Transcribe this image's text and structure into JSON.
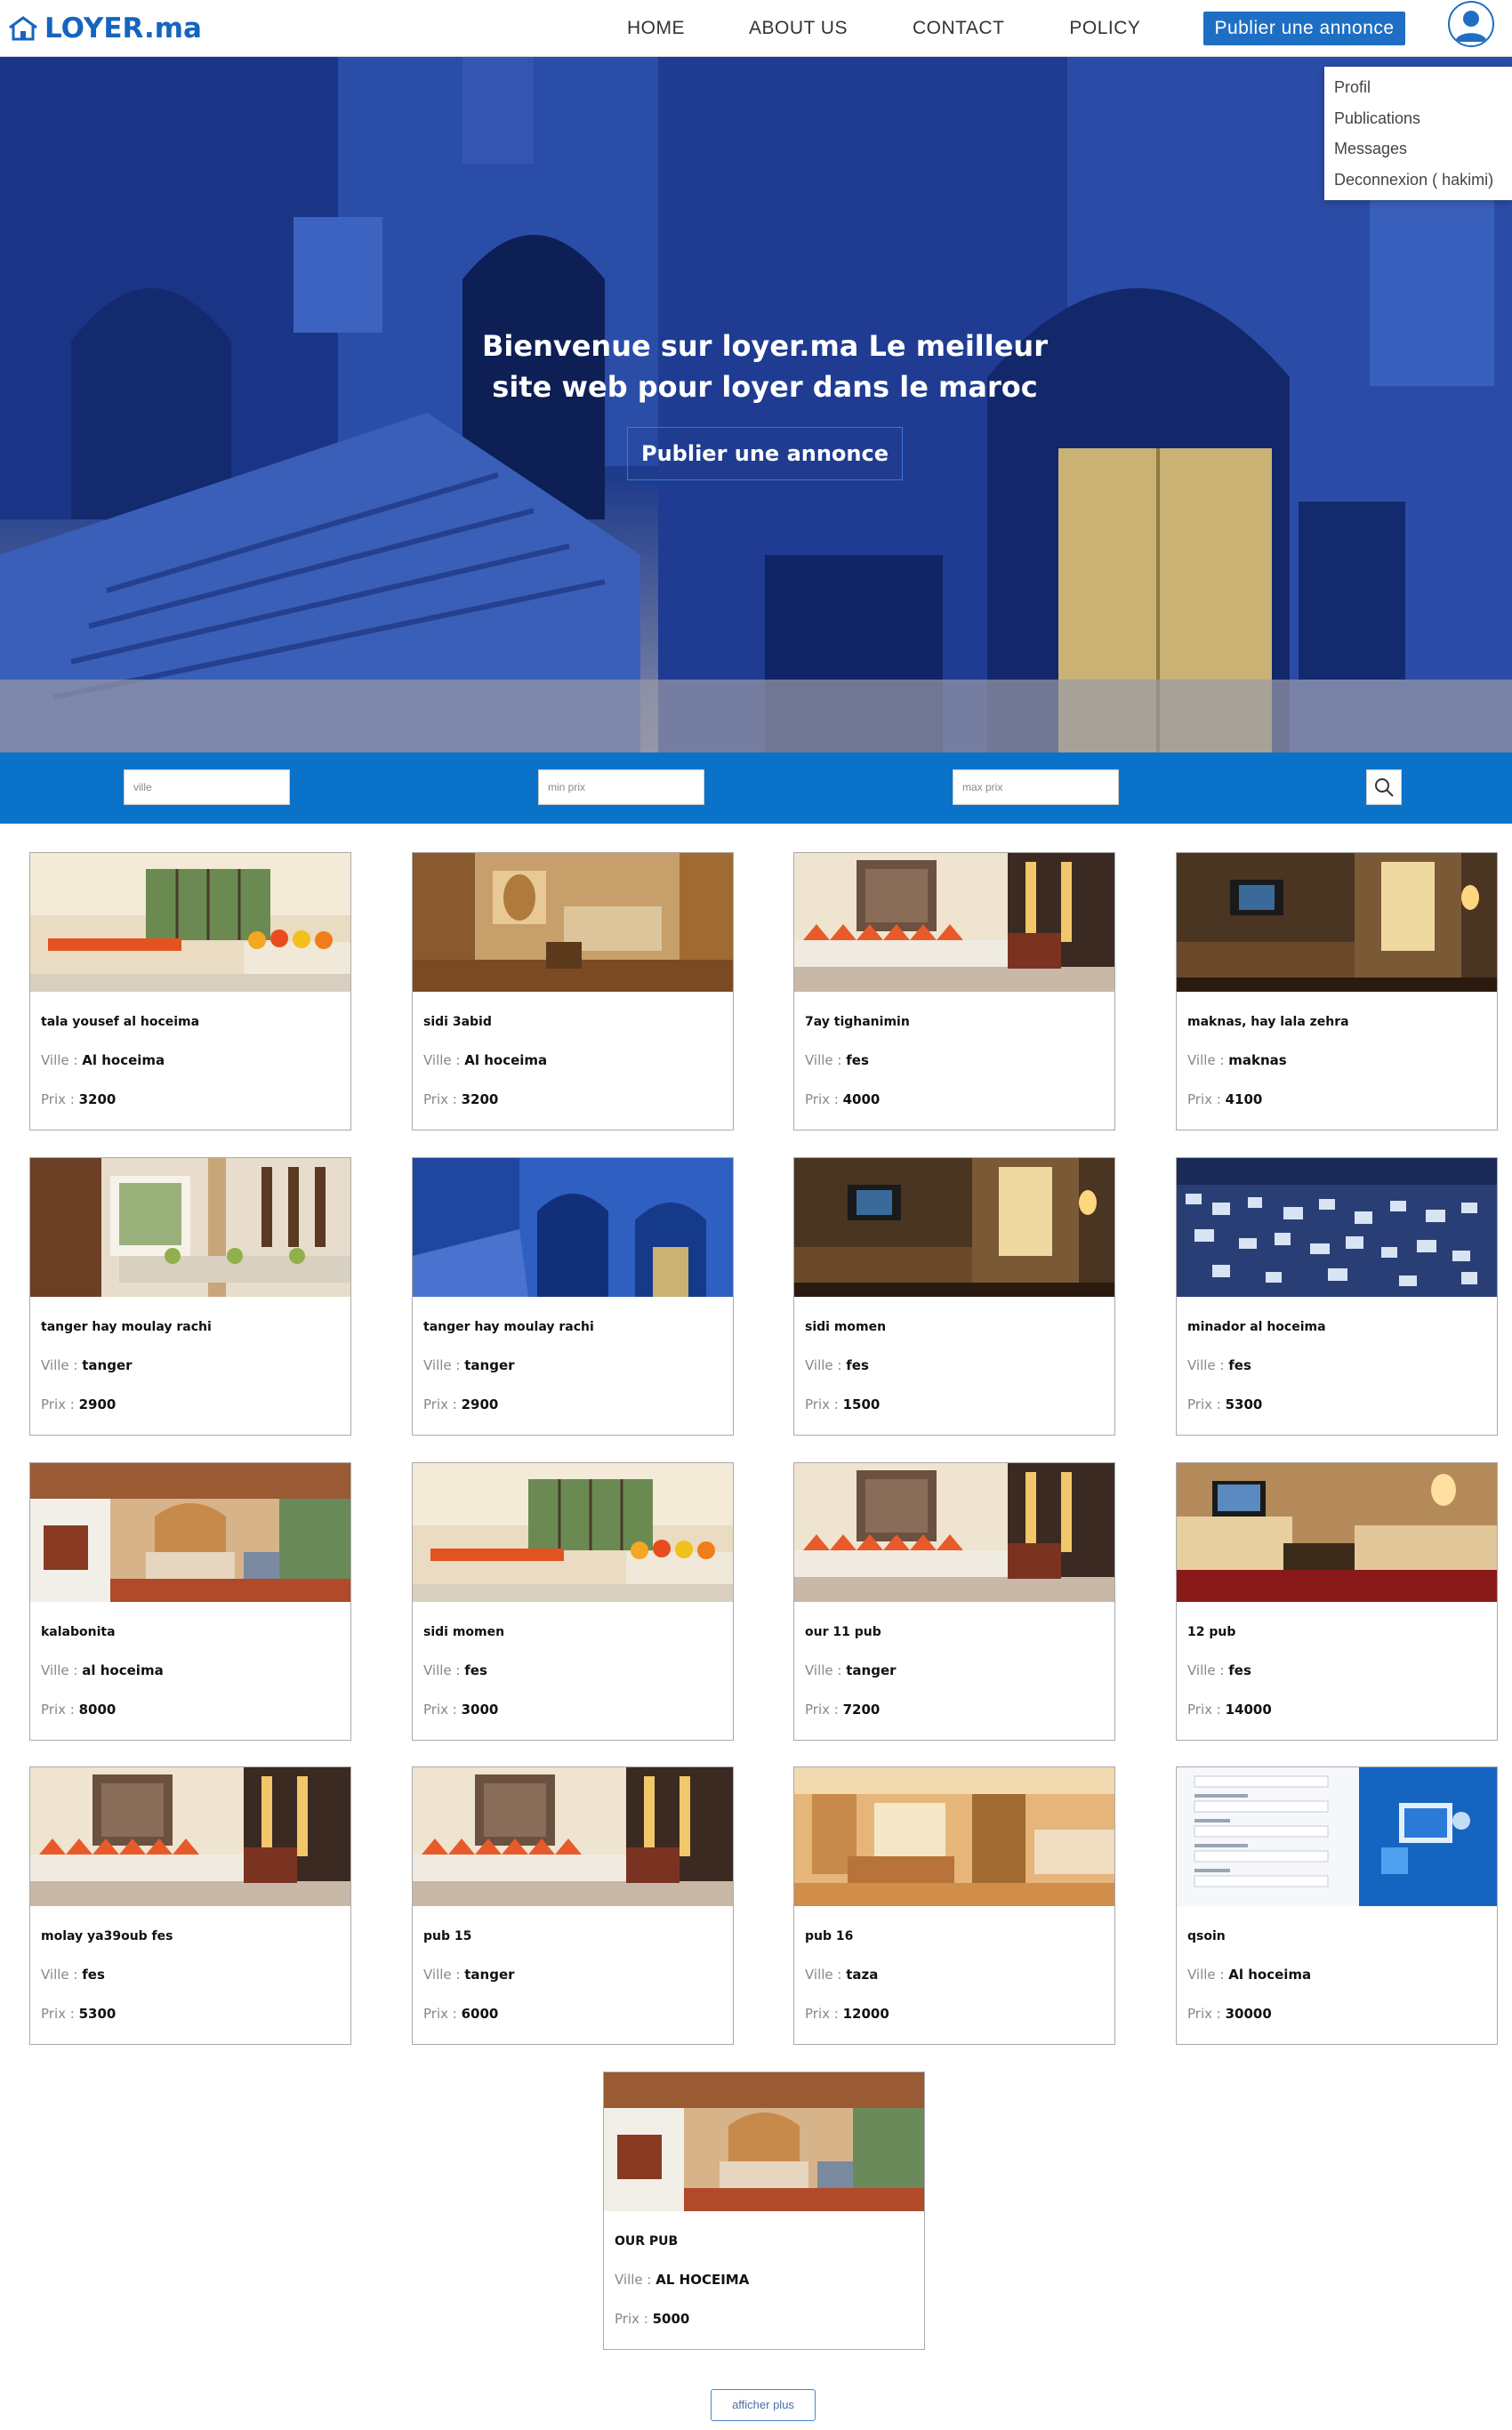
{
  "header": {
    "logo_text": "LOYER.ma",
    "nav": [
      "HOME",
      "ABOUT US",
      "CONTACT",
      "POLICY"
    ],
    "publish_label": "Publier une annonce"
  },
  "user_menu": [
    "Profil",
    "Publications",
    "Messages",
    "Deconnexion ( hakimi)"
  ],
  "hero": {
    "title_line1": "Bienvenue sur loyer.ma Le meilleur",
    "title_line2": "site web pour loyer dans le maroc",
    "button_label": "Publier une annonce"
  },
  "search": {
    "ville_placeholder": "ville",
    "min_placeholder": "min prix",
    "max_placeholder": "max prix"
  },
  "labels": {
    "ville": "Ville : ",
    "prix": "Prix : "
  },
  "listings": [
    {
      "title": "tala yousef al hoceima",
      "ville": "Al hoceima",
      "prix": "3200",
      "img": "dining-orange"
    },
    {
      "title": "sidi 3abid",
      "ville": "Al hoceima",
      "prix": "3200",
      "img": "hotel-room"
    },
    {
      "title": "7ay tighanimin",
      "ville": "fes",
      "prix": "4000",
      "img": "moroccan-salon"
    },
    {
      "title": "maknas, hay lala zehra",
      "ville": "maknas",
      "prix": "4100",
      "img": "dark-living"
    },
    {
      "title": "tanger hay moulay rachi",
      "ville": "tanger",
      "prix": "2900",
      "img": "riad-salon"
    },
    {
      "title": "tanger hay moulay rachi",
      "ville": "tanger",
      "prix": "2900",
      "img": "blue-street"
    },
    {
      "title": "sidi momen",
      "ville": "fes",
      "prix": "1500",
      "img": "dark-living"
    },
    {
      "title": "minador al hoceima",
      "ville": "fes",
      "prix": "5300",
      "img": "blue-city"
    },
    {
      "title": "kalabonita",
      "ville": "al hoceima",
      "prix": "8000",
      "img": "riad-bedroom"
    },
    {
      "title": "sidi momen",
      "ville": "fes",
      "prix": "3000",
      "img": "dining-orange"
    },
    {
      "title": "our 11 pub",
      "ville": "tanger",
      "prix": "7200",
      "img": "moroccan-salon"
    },
    {
      "title": "12 pub",
      "ville": "fes",
      "prix": "14000",
      "img": "red-living"
    },
    {
      "title": "molay ya39oub fes",
      "ville": "fes",
      "prix": "5300",
      "img": "moroccan-salon"
    },
    {
      "title": "pub 15",
      "ville": "tanger",
      "prix": "6000",
      "img": "moroccan-salon"
    },
    {
      "title": "pub 16",
      "ville": "taza",
      "prix": "12000",
      "img": "suite"
    },
    {
      "title": "qsoin",
      "ville": "Al hoceima",
      "prix": "30000",
      "img": "form-screenshot"
    },
    {
      "title": "OUR PUB",
      "ville": "AL HOCEIMA",
      "prix": "5000",
      "img": "riad-bedroom"
    }
  ],
  "more_label": "afficher plus",
  "colors": {
    "brand": "#1e6fc4",
    "search_bar": "#0a73c9"
  }
}
